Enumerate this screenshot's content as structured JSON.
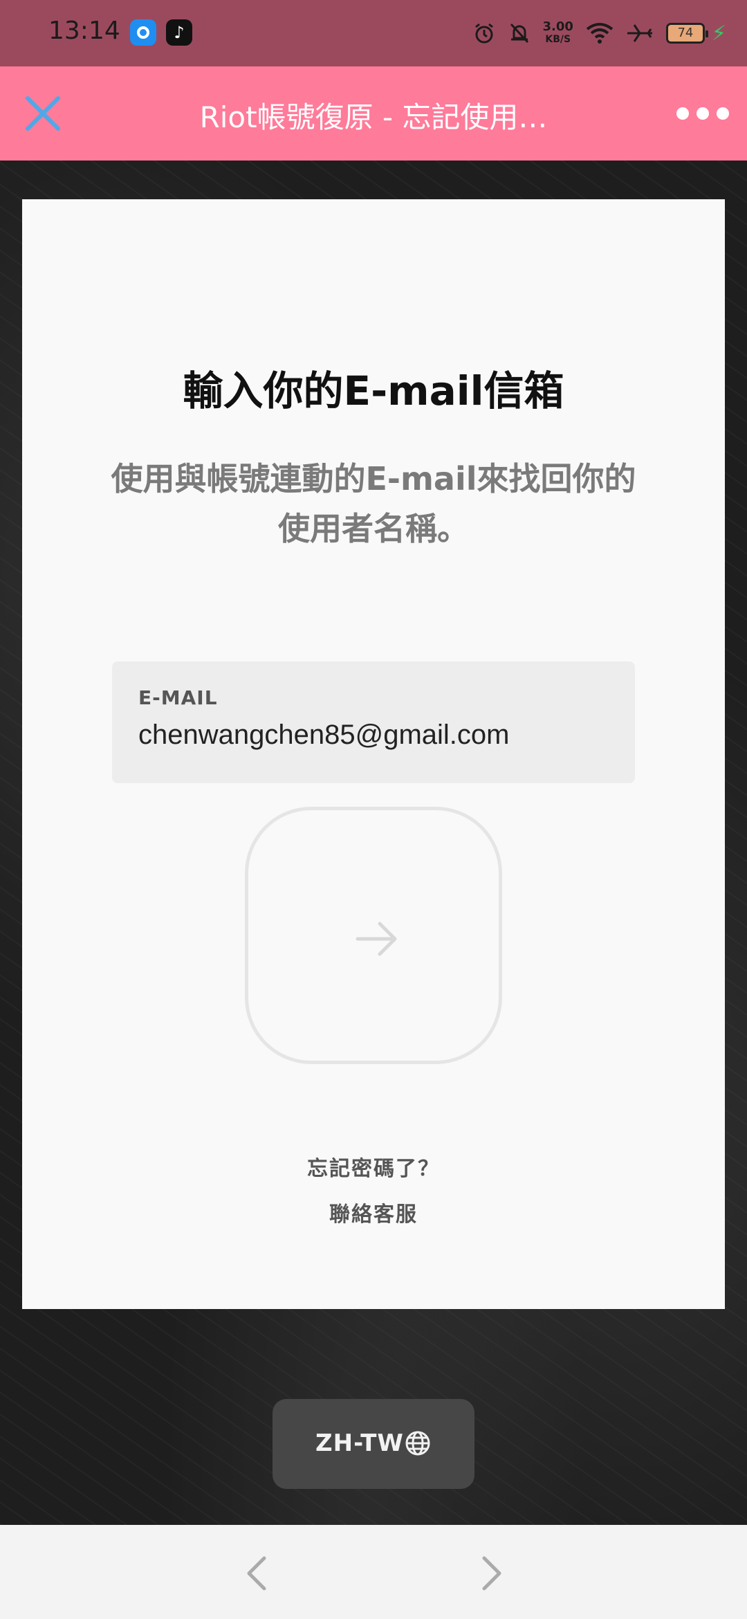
{
  "status_bar": {
    "time": "13:14",
    "net_speed_value": "3.00",
    "net_speed_unit": "KB/S",
    "battery_level": "74",
    "icons": [
      "app-icon-blue",
      "tiktok-icon",
      "alarm-icon",
      "bell-off-icon",
      "wifi-icon",
      "airplane-icon",
      "battery-icon",
      "charging-bolt-icon"
    ]
  },
  "header": {
    "title": "Riot帳號復原 - 忘記使用…",
    "close_icon": "close-icon",
    "more_icon": "more-icon"
  },
  "card": {
    "title": "輸入你的E-mail信箱",
    "subtitle": "使用與帳號連動的E-mail來找回你的使用者名稱。",
    "email_field": {
      "label": "E-MAIL",
      "value": "chenwangchen85@gmail.com"
    },
    "submit_icon": "arrow-right-icon",
    "forgot_password": "忘記密碼了？",
    "contact_support": "聯絡客服"
  },
  "language": {
    "label": "ZH-TW",
    "icon": "globe-icon"
  },
  "colors": {
    "status_bar": "#9b4a5e",
    "header": "#ff7b9a",
    "close_icon": "#4fa8e8"
  }
}
